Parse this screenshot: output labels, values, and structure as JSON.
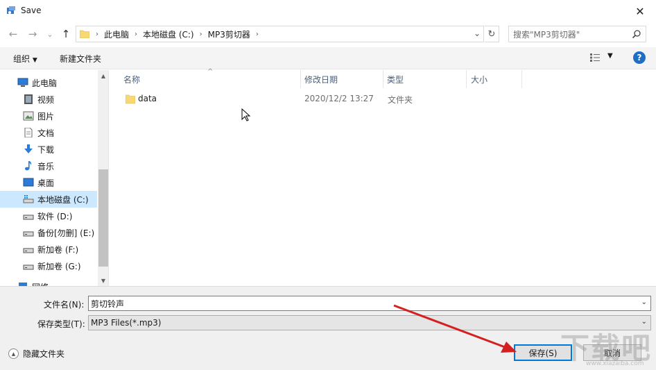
{
  "window": {
    "title": "Save",
    "close_glyph": "✕"
  },
  "nav": {
    "back_glyph": "←",
    "forward_glyph": "→",
    "recent_glyph": "⌄",
    "up_glyph": "↑",
    "breadcrumbs": [
      "此电脑",
      "本地磁盘 (C:)",
      "MP3剪切器"
    ],
    "search_placeholder": "搜索\"MP3剪切器\""
  },
  "toolbar": {
    "organize_label": "组织",
    "new_folder_label": "新建文件夹",
    "help_label": "?"
  },
  "sidebar": {
    "items": [
      {
        "label": "此电脑",
        "icon": "computer-icon"
      },
      {
        "label": "视频",
        "icon": "video-icon"
      },
      {
        "label": "图片",
        "icon": "pictures-icon"
      },
      {
        "label": "文档",
        "icon": "documents-icon"
      },
      {
        "label": "下载",
        "icon": "download-icon"
      },
      {
        "label": "音乐",
        "icon": "music-icon"
      },
      {
        "label": "桌面",
        "icon": "desktop-icon"
      },
      {
        "label": "本地磁盘 (C:)",
        "icon": "drive-c-icon"
      },
      {
        "label": "软件 (D:)",
        "icon": "drive-icon"
      },
      {
        "label": "备份[勿删] (E:)",
        "icon": "drive-icon"
      },
      {
        "label": "新加卷 (F:)",
        "icon": "drive-icon"
      },
      {
        "label": "新加卷 (G:)",
        "icon": "drive-icon"
      },
      {
        "label": "网络",
        "icon": "network-icon"
      }
    ],
    "selected_index": 7
  },
  "filelist": {
    "columns": [
      "名称",
      "修改日期",
      "类型",
      "大小"
    ],
    "rows": [
      {
        "name": "data",
        "modified": "2020/12/2 13:27",
        "type": "文件夹",
        "size": ""
      }
    ]
  },
  "form": {
    "filename_label": "文件名(N):",
    "filename_value": "剪切铃声",
    "filetype_label": "保存类型(T):",
    "filetype_value": "MP3 Files(*.mp3)",
    "hide_folders_label": "隐藏文件夹",
    "save_label": "保存(S)",
    "cancel_label": "取消"
  },
  "watermark": {
    "text": "下载吧",
    "url": "www.xiazaiba.com"
  },
  "colors": {
    "accent": "#0078d7",
    "selection": "#cce8ff",
    "annotation_arrow": "#d42020",
    "folder": "#f8d775"
  }
}
